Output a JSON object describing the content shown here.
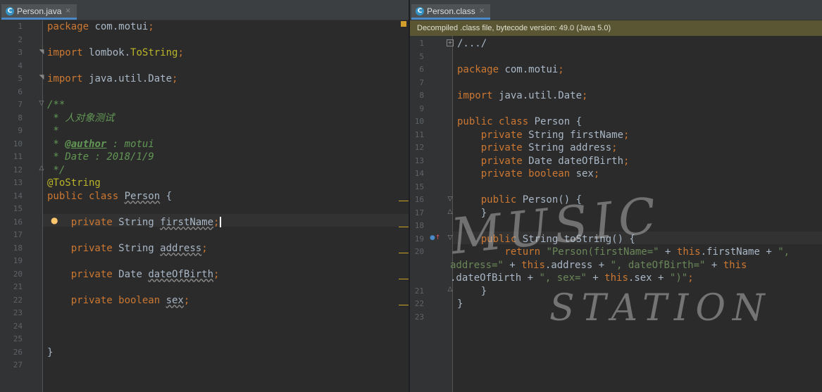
{
  "left_editor": {
    "tab": {
      "icon": "java-class-icon",
      "icon_letter": "C",
      "label": "Person.java",
      "close": "×"
    },
    "lines": [
      [
        {
          "t": "package ",
          "c": "kw"
        },
        {
          "t": "com.motui"
        },
        {
          "t": ";",
          "c": "kw"
        }
      ],
      [],
      [
        {
          "t": "import ",
          "c": "kw"
        },
        {
          "t": "lombok."
        },
        {
          "t": "ToString",
          "c": "ann"
        },
        {
          "t": ";",
          "c": "kw"
        }
      ],
      [],
      [
        {
          "t": "import ",
          "c": "kw"
        },
        {
          "t": "java.util.Date"
        },
        {
          "t": ";",
          "c": "kw"
        }
      ],
      [],
      [
        {
          "t": "/**",
          "c": "cmt"
        }
      ],
      [
        {
          "t": " * 人对象测试",
          "c": "cmt"
        }
      ],
      [
        {
          "t": " *",
          "c": "cmt"
        }
      ],
      [
        {
          "t": " * ",
          "c": "cmt"
        },
        {
          "t": "@author",
          "c": "tag"
        },
        {
          "t": " : motui",
          "c": "cmt"
        }
      ],
      [
        {
          "t": " * Date : 2018/1/9",
          "c": "cmt"
        }
      ],
      [
        {
          "t": " */",
          "c": "cmt"
        }
      ],
      [
        {
          "t": "@ToString",
          "c": "ann"
        }
      ],
      [
        {
          "t": "public class ",
          "c": "kw"
        },
        {
          "t": "Person",
          "c": "squig"
        },
        {
          "t": " {"
        }
      ],
      [],
      [
        {
          "t": "    private ",
          "c": "kw"
        },
        {
          "t": "String "
        },
        {
          "t": "firstName",
          "c": "squig"
        },
        {
          "t": ";",
          "c": "kw"
        },
        {
          "cursor": true
        }
      ],
      [],
      [
        {
          "t": "    private ",
          "c": "kw"
        },
        {
          "t": "String "
        },
        {
          "t": "address",
          "c": "squig"
        },
        {
          "t": ";",
          "c": "kw"
        }
      ],
      [],
      [
        {
          "t": "    private ",
          "c": "kw"
        },
        {
          "t": "Date "
        },
        {
          "t": "dateOfBirth",
          "c": "squig"
        },
        {
          "t": ";",
          "c": "kw"
        }
      ],
      [],
      [
        {
          "t": "    private boolean ",
          "c": "kw"
        },
        {
          "t": "sex",
          "c": "squig"
        },
        {
          "t": ";",
          "c": "kw"
        }
      ],
      [],
      [],
      [],
      [
        {
          "t": "}"
        }
      ],
      []
    ]
  },
  "right_editor": {
    "tab": {
      "icon": "java-class-icon",
      "icon_letter": "C",
      "label": "Person.class",
      "close": "×"
    },
    "banner": "Decompiled .class file, bytecode version: 49.0 (Java 5.0)",
    "folded_placeholder": "/.../",
    "rows": [
      {
        "n": "1",
        "seg": [
          {
            "t": "/.../",
            "c": "fold"
          }
        ]
      },
      {
        "n": "5",
        "seg": []
      },
      {
        "n": "6",
        "seg": [
          {
            "t": "package ",
            "c": "kw"
          },
          {
            "t": "com.motui"
          },
          {
            "t": ";",
            "c": "kw"
          }
        ]
      },
      {
        "n": "7",
        "seg": []
      },
      {
        "n": "8",
        "seg": [
          {
            "t": "import ",
            "c": "kw"
          },
          {
            "t": "java.util.Date"
          },
          {
            "t": ";",
            "c": "kw"
          }
        ]
      },
      {
        "n": "9",
        "seg": []
      },
      {
        "n": "10",
        "seg": [
          {
            "t": "public class ",
            "c": "kw"
          },
          {
            "t": "Person {"
          }
        ]
      },
      {
        "n": "11",
        "seg": [
          {
            "t": "    private ",
            "c": "kw"
          },
          {
            "t": "String firstName"
          },
          {
            "t": ";",
            "c": "kw"
          }
        ]
      },
      {
        "n": "12",
        "seg": [
          {
            "t": "    private ",
            "c": "kw"
          },
          {
            "t": "String address"
          },
          {
            "t": ";",
            "c": "kw"
          }
        ]
      },
      {
        "n": "13",
        "seg": [
          {
            "t": "    private ",
            "c": "kw"
          },
          {
            "t": "Date dateOfBirth"
          },
          {
            "t": ";",
            "c": "kw"
          }
        ]
      },
      {
        "n": "14",
        "seg": [
          {
            "t": "    private boolean ",
            "c": "kw"
          },
          {
            "t": "sex"
          },
          {
            "t": ";",
            "c": "kw"
          }
        ]
      },
      {
        "n": "15",
        "seg": []
      },
      {
        "n": "16",
        "seg": [
          {
            "t": "    public ",
            "c": "kw"
          },
          {
            "t": "Person() {"
          }
        ]
      },
      {
        "n": "17",
        "seg": [
          {
            "t": "    }"
          }
        ]
      },
      {
        "n": "18",
        "seg": []
      },
      {
        "n": "19",
        "seg": [
          {
            "t": "    public ",
            "c": "kw"
          },
          {
            "t": "String toString() {"
          }
        ]
      },
      {
        "n": "20",
        "seg": [
          {
            "t": "        return ",
            "c": "kw"
          },
          {
            "t": "\"Person(firstName=\"",
            "c": "str"
          },
          {
            "t": " + "
          },
          {
            "t": "this",
            "c": "kw"
          },
          {
            "t": ".firstName + "
          },
          {
            "t": "\",",
            "c": "str"
          }
        ]
      },
      {
        "n": "",
        "seg": [
          {
            "t": "address=\"",
            "c": "str"
          },
          {
            "t": " + "
          },
          {
            "t": "this",
            "c": "kw"
          },
          {
            "t": ".address + "
          },
          {
            "t": "\", dateOfBirth=\"",
            "c": "str"
          },
          {
            "t": " + "
          },
          {
            "t": "this",
            "c": "kw"
          }
        ]
      },
      {
        "n": "",
        "seg": [
          {
            "t": ".dateOfBirth + "
          },
          {
            "t": "\", sex=\"",
            "c": "str"
          },
          {
            "t": " + "
          },
          {
            "t": "this",
            "c": "kw"
          },
          {
            "t": ".sex + "
          },
          {
            "t": "\")\"",
            "c": "str"
          },
          {
            "t": ";",
            "c": "kw"
          }
        ]
      },
      {
        "n": "21",
        "seg": [
          {
            "t": "    }"
          }
        ]
      },
      {
        "n": "22",
        "seg": [
          {
            "t": "}"
          }
        ]
      },
      {
        "n": "23",
        "seg": []
      }
    ]
  },
  "watermark": {
    "line1": "MUSIC",
    "line2": "STATION"
  },
  "colors": {
    "keyword": "#cc7832",
    "annotation": "#bbb529",
    "string": "#6a8759",
    "comment": "#629755",
    "identifier": "#a9b7c6",
    "background": "#2b2b2b",
    "gutter": "#313335",
    "accent": "#4a88c7"
  }
}
